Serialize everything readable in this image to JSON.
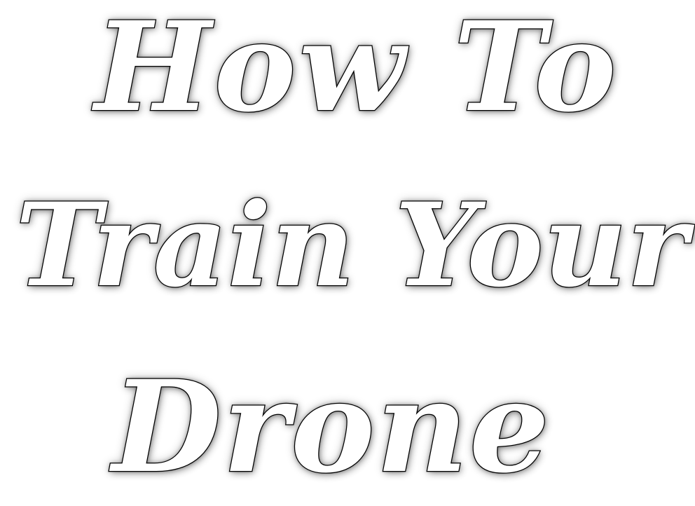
{
  "title": {
    "line1": "How To",
    "line2": "Train Your",
    "line3": "Drone"
  },
  "colors": {
    "background": "#ffffff",
    "letter_fill": "#ffffff",
    "letter_outline": "#000000",
    "glow": "#808080"
  }
}
